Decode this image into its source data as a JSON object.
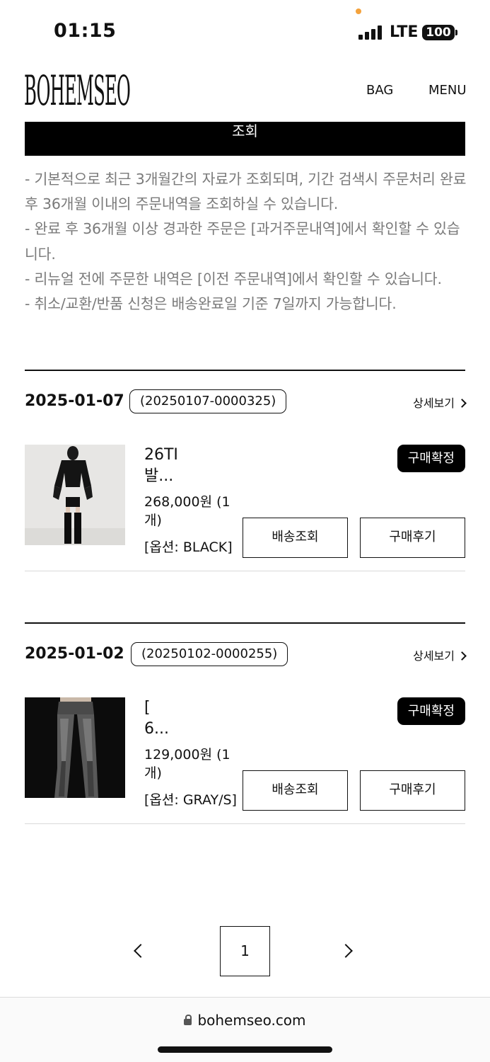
{
  "status_bar": {
    "time": "01:15",
    "network": "LTE",
    "battery": "100"
  },
  "header": {
    "logo": "BOHEMSEO",
    "bag": "BAG",
    "menu": "MENU"
  },
  "search_button": "조회",
  "notices": [
    "- 기본적으로 최근 3개월간의 자료가 조회되며, 기간 검색시 주문처리 완료 후 36개월 이내의 주문내역을 조회하실 수 있습니다.",
    "- 완료 후 36개월 이상 경과한 주문은 [과거주문내역]에서 확인할 수 있습니다.",
    "- 리뉴얼 전에 주문한 내역은 [이전 주문내역]에서 확인할 수 있습니다.",
    "- 취소/교환/반품 신청은 배송완료일 기준 7일까지 가능합니다."
  ],
  "orders": [
    {
      "date": "2025-01-07",
      "order_no": "(20250107-0000325)",
      "detail_link": "상세보기",
      "product_name": "26TI\n발...",
      "price": "268,000원 (1개)",
      "option": "[옵션: BLACK]",
      "status": "구매확정",
      "track_btn": "배송조회",
      "review_btn": "구매후기"
    },
    {
      "date": "2025-01-02",
      "order_no": "(20250102-0000255)",
      "detail_link": "상세보기",
      "product_name": "[\n6...",
      "price": "129,000원 (1개)",
      "option": "[옵션: GRAY/S]",
      "status": "구매확정",
      "track_btn": "배송조회",
      "review_btn": "구매후기"
    }
  ],
  "pagination": {
    "current_page": "1"
  },
  "url_bar": {
    "url": "bohemseo.com"
  },
  "icons": [
    "signal-icon",
    "battery-icon",
    "chevron-right-icon",
    "chevron-left-icon",
    "lock-icon"
  ]
}
